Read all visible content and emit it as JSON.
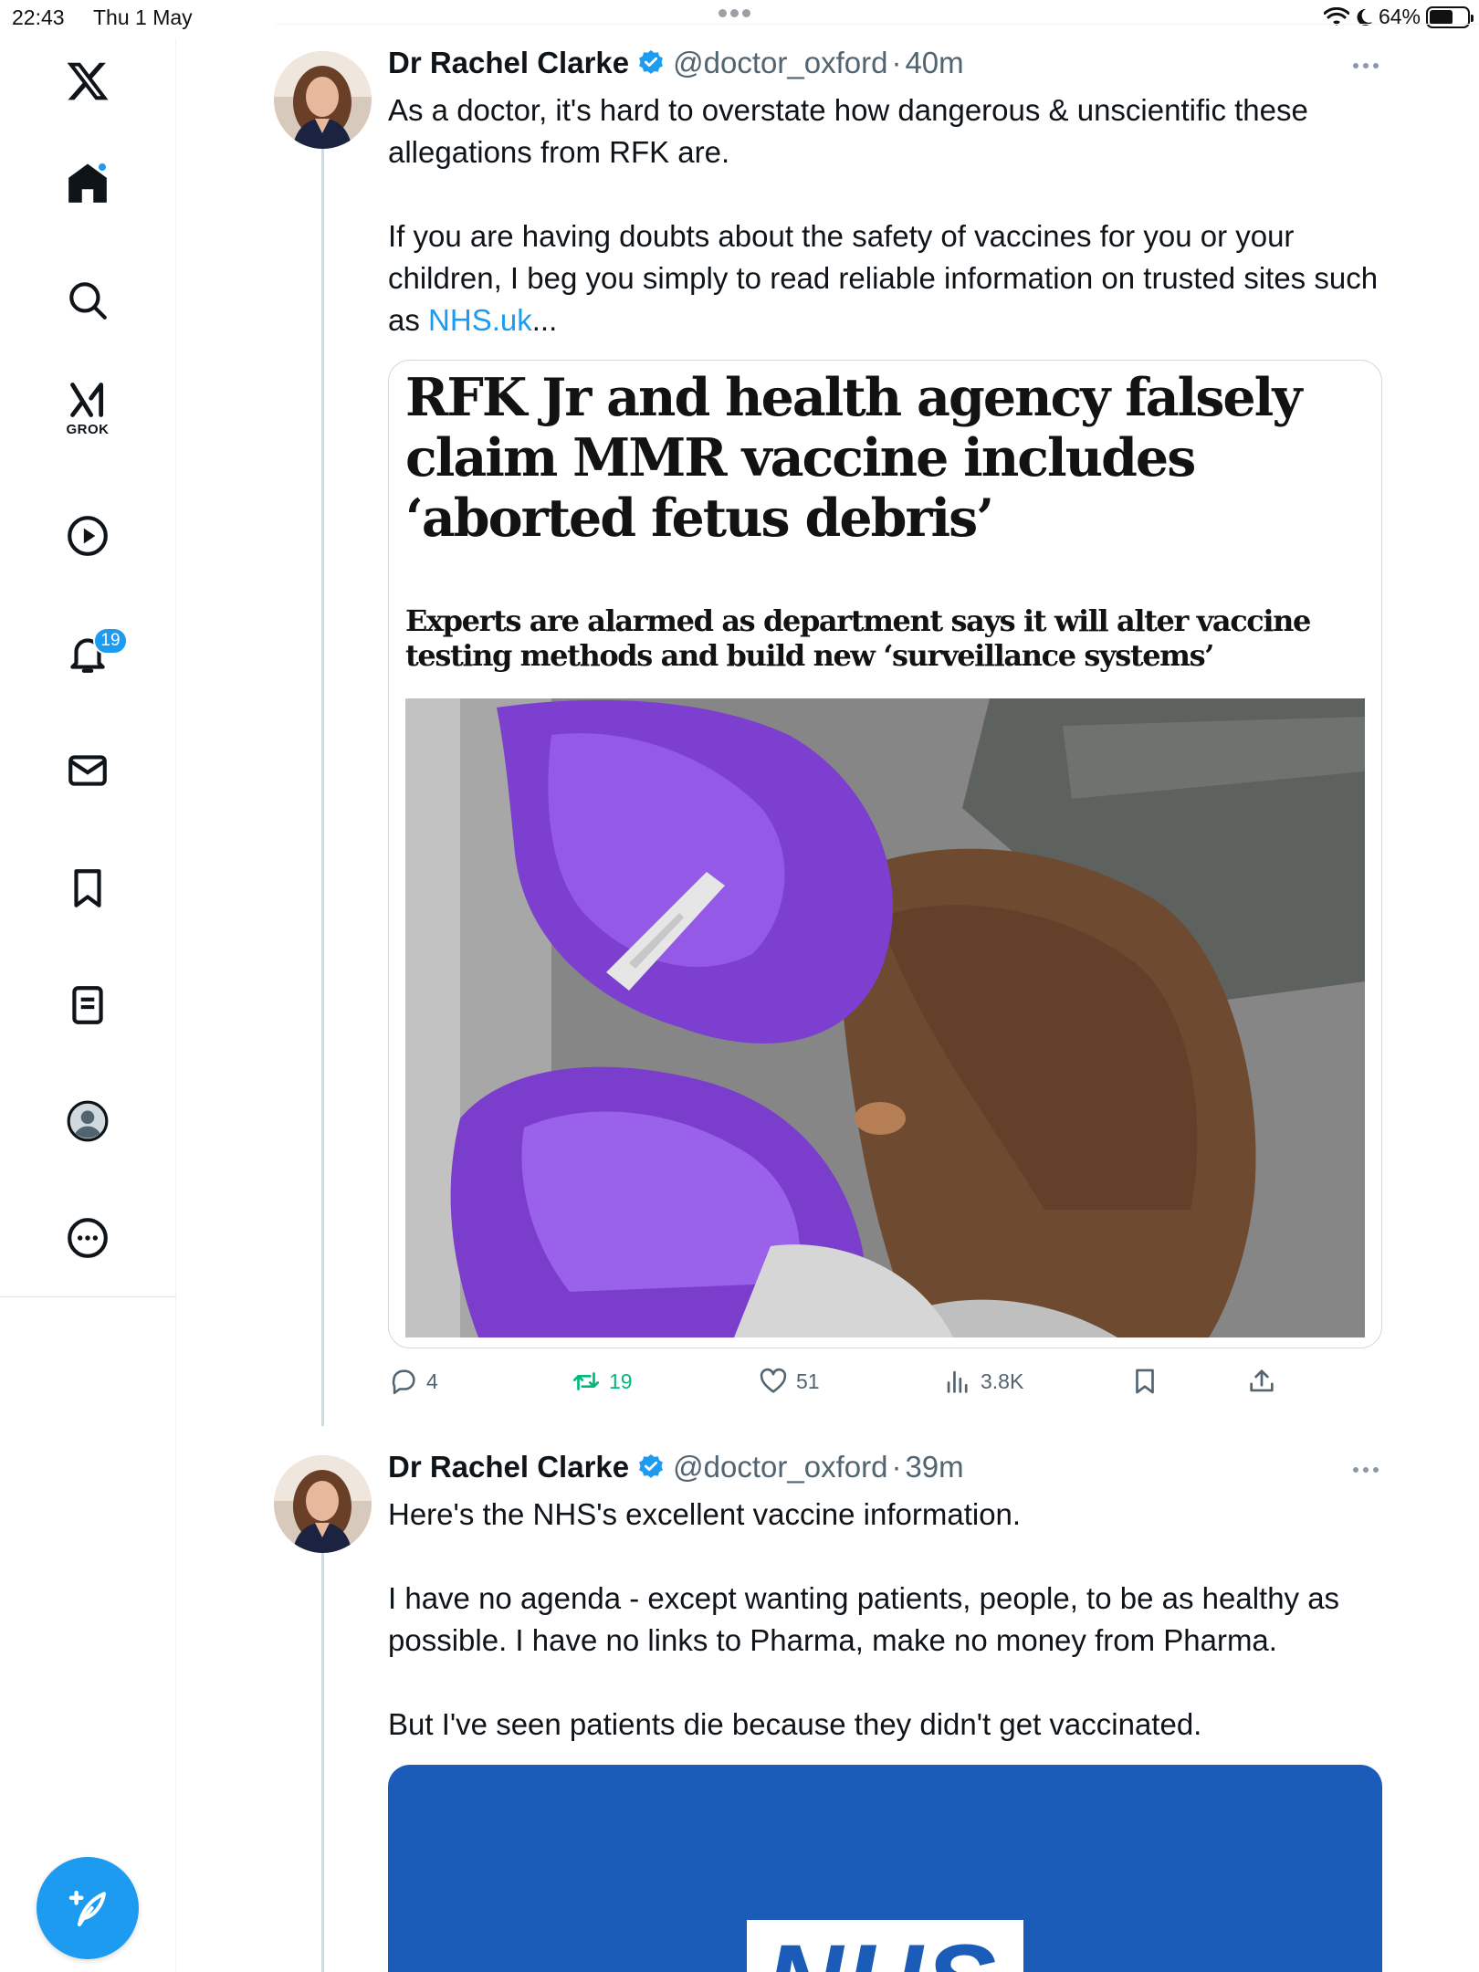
{
  "status_bar": {
    "time": "22:43",
    "date": "Thu 1 May",
    "battery": "64%",
    "battery_level": 0.64
  },
  "sidebar": {
    "items": [
      {
        "icon": "x-logo-icon",
        "label": ""
      },
      {
        "icon": "home-icon",
        "label": ""
      },
      {
        "icon": "search-icon",
        "label": ""
      },
      {
        "icon": "grok-icon",
        "label": "GROK"
      },
      {
        "icon": "video-play-icon",
        "label": ""
      },
      {
        "icon": "notifications-bell-icon",
        "badge": "19"
      },
      {
        "icon": "messages-envelope-icon",
        "label": ""
      },
      {
        "icon": "bookmark-icon",
        "label": ""
      },
      {
        "icon": "lists-icon",
        "label": ""
      },
      {
        "icon": "profile-avatar-icon",
        "label": ""
      },
      {
        "icon": "more-circle-icon",
        "label": ""
      }
    ],
    "compose_icon": "compose-feather-icon"
  },
  "colors": {
    "accent": "#1d9bf0",
    "retweet": "#00ba7c",
    "secondary_text": "#536471",
    "nhs_blue": "#1a5cb8"
  },
  "tweets": [
    {
      "author": "Dr Rachel Clarke",
      "handle": "@doctor_oxford",
      "separator": "·",
      "time": "40m",
      "text": {
        "p1": "As a doctor, it's hard to overstate how dangerous & unscientific these allegations from RFK are.",
        "p2_pre": "If you are having doubts about the safety of vaccines for you or your children, I beg you simply to read reliable information on trusted sites such as ",
        "p2_link": "NHS.uk",
        "p2_post": "..."
      },
      "card": {
        "headline": "RFK Jr and health agency falsely claim MMR vaccine includes ‘aborted fetus debris’",
        "standfirst": "Experts are alarmed as department says it will alter vaccine testing methods and build new ‘surveillance systems’"
      },
      "actions": {
        "replies": "4",
        "retweets": "19",
        "likes": "51",
        "views": "3.8K"
      }
    },
    {
      "author": "Dr Rachel Clarke",
      "handle": "@doctor_oxford",
      "separator": "·",
      "time": "39m",
      "text": {
        "p1": "Here's the NHS's excellent vaccine information.",
        "p2": "I have no agenda - except wanting patients, people, to be as healthy as possible. I have no links to Pharma, make no money from Pharma.",
        "p3": "But I've seen patients die because they didn't get vaccinated."
      },
      "card": {
        "logo": "NHS"
      }
    }
  ]
}
